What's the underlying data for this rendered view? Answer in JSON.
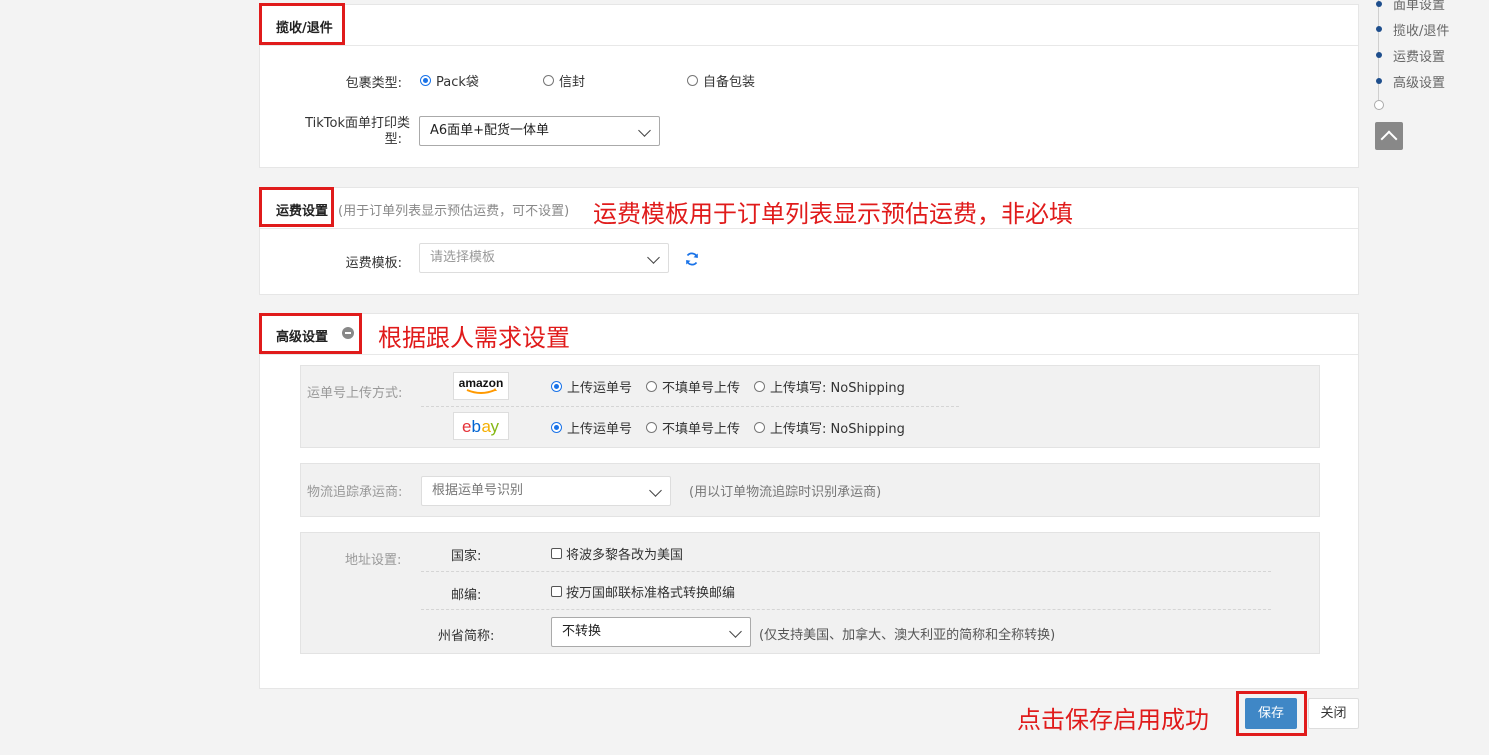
{
  "pickup_section": {
    "title": "揽收/退件",
    "package_label": "包裹类型:",
    "package_options": [
      "Pack袋",
      "信封",
      "自备包装"
    ],
    "package_selected": "Pack袋",
    "tiktok_label_line1": "TikTok面单打印类",
    "tiktok_label_line2": "型:",
    "tiktok_value": "A6面单+配货一体单"
  },
  "shipping_section": {
    "title": "运费设置",
    "hint": "(用于订单列表显示预估运费，可不设置)",
    "annotation": "运费模板用于订单列表显示预估运费，非必填",
    "template_label": "运费模板:",
    "template_placeholder": "请选择模板"
  },
  "advanced_section": {
    "title": "高级设置",
    "annotation": "根据跟人需求设置",
    "upload_label": "运单号上传方式:",
    "platforms": [
      {
        "logo": "amazon",
        "options": [
          "上传运单号",
          "不填单号上传",
          "上传填写: NoShipping"
        ],
        "selected": "上传运单号"
      },
      {
        "logo": "ebay",
        "options": [
          "上传运单号",
          "不填单号上传",
          "上传填写: NoShipping"
        ],
        "selected": "上传运单号"
      }
    ],
    "carrier_label": "物流追踪承运商:",
    "carrier_value": "根据运单号识别",
    "carrier_hint": "(用以订单物流追踪时识别承运商)",
    "address_label": "地址设置:",
    "country_label": "国家:",
    "country_check": "将波多黎各改为美国",
    "zip_label": "邮编:",
    "zip_check": "按万国邮联标准格式转换邮编",
    "state_label": "州省简称:",
    "state_value": "不转换",
    "state_hint": "(仅支持美国、加拿大、澳大利亚的简称和全称转换)"
  },
  "footer": {
    "annotation": "点击保存启用成功",
    "save_label": "保存",
    "close_label": "关闭"
  },
  "side_nav": {
    "items": [
      "面单设置",
      "揽收/退件",
      "运费设置",
      "高级设置"
    ]
  },
  "colors": {
    "annotation_red": "#e01b1b",
    "primary_blue": "#3f87c6",
    "nav_dot": "#1e4e8c"
  }
}
